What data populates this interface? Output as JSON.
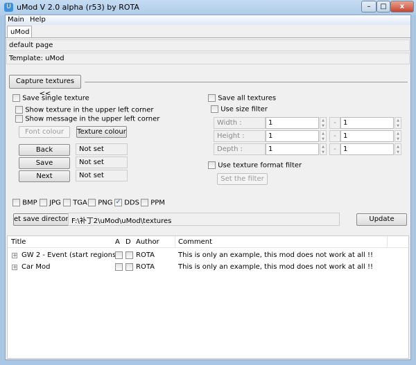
{
  "window": {
    "title": "uMod V 2.0 alpha (r53)  by  ROTA"
  },
  "menu": [
    "Main",
    "Help"
  ],
  "tab": "uMod",
  "page_name": "default page",
  "template": "Template: uMod",
  "capture_button": "Capture textures <<",
  "left": {
    "save_single": "Save single texture",
    "show_texture": "Show texture in the upper left corner",
    "show_message": "Show message in the upper left corner",
    "font_colour": "Font colour",
    "texture_colour": "Texture colour",
    "keys": [
      {
        "label": "Back",
        "value": "Not set"
      },
      {
        "label": "Save",
        "value": "Not set"
      },
      {
        "label": "Next",
        "value": "Not set"
      }
    ]
  },
  "right": {
    "save_all": "Save all textures",
    "use_size_filter": "Use size filter",
    "sizes": [
      {
        "label": "Width :",
        "min": "1",
        "max": "1"
      },
      {
        "label": "Height :",
        "min": "1",
        "max": "1"
      },
      {
        "label": "Depth :",
        "min": "1",
        "max": "1"
      }
    ],
    "dash": "-",
    "use_format_filter": "Use texture format filter",
    "set_filter": "Set the filter"
  },
  "formats": [
    {
      "label": "BMP",
      "checked": false
    },
    {
      "label": "JPG",
      "checked": false
    },
    {
      "label": "TGA",
      "checked": false
    },
    {
      "label": "PNG",
      "checked": false
    },
    {
      "label": "DDS",
      "checked": true
    },
    {
      "label": "PPM",
      "checked": false
    }
  ],
  "save_dir_button": "et save director",
  "save_dir": "F:\\补丁2\\uMod\\uMod\\textures",
  "update": "Update",
  "table": {
    "headers": [
      "Title",
      "A",
      "D",
      "Author",
      "Comment"
    ],
    "rows": [
      {
        "title": "GW 2 - Event  (start regions)",
        "author": "ROTA",
        "comment": "This is only an example, this mod does not work at all !!"
      },
      {
        "title": "Car Mod",
        "author": "ROTA",
        "comment": "This is only an example, this mod does not work at all !!"
      }
    ]
  }
}
